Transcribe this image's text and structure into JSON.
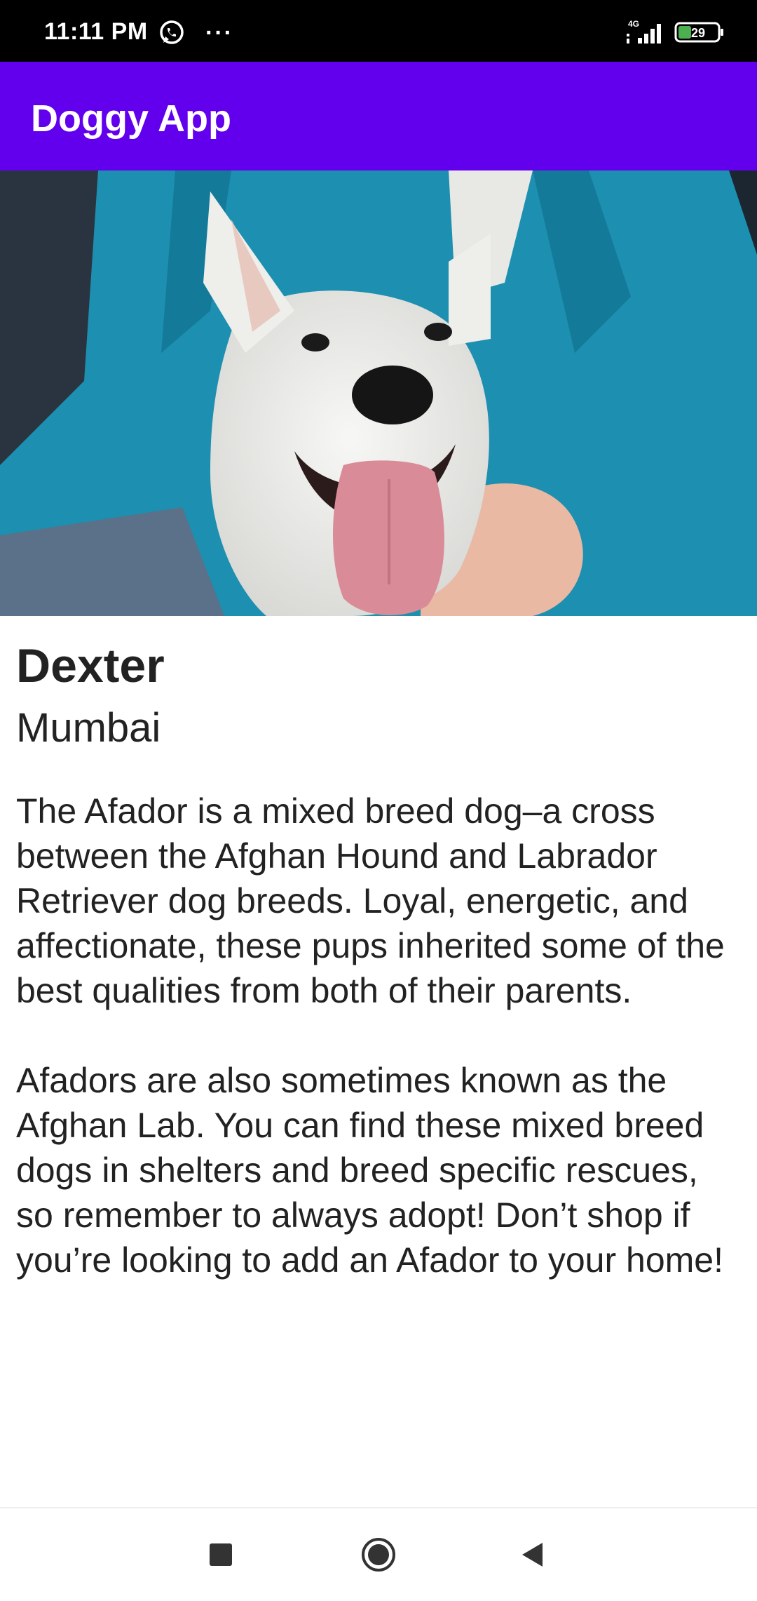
{
  "status_bar": {
    "time": "11:11 PM",
    "more_indicator": "···",
    "network_label": "4G",
    "battery_level": "29",
    "icons": [
      "whatsapp-icon",
      "signal-icon",
      "battery-icon"
    ]
  },
  "app_bar": {
    "title": "Doggy App",
    "color": "#6200ee"
  },
  "dog": {
    "name": "Dexter",
    "location": "Mumbai",
    "description": "The Afador is a mixed breed dog–a cross between the Afghan Hound and Labrador Retriever dog breeds. Loyal, energetic, and affectionate, these pups inherited some of the best qualities from both of their parents.\n\nAfadors are also sometimes known as the Afghan Lab. You can find these mixed breed dogs in shelters and breed specific rescues, so remember to always adopt! Don’t shop if you’re looking to add an Afador to your home!"
  },
  "nav_bar": {
    "buttons": [
      "recents-button",
      "home-button",
      "back-button"
    ]
  }
}
